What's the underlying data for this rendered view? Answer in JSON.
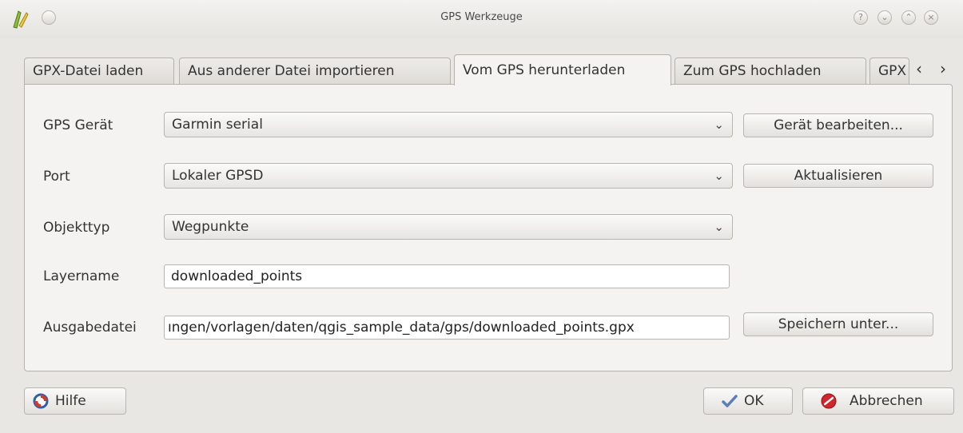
{
  "window": {
    "title": "GPS Werkzeuge",
    "controls": [
      "help-icon",
      "minimize-icon",
      "maximize-icon",
      "close-icon"
    ]
  },
  "tabs": [
    {
      "label": "GPX-Datei laden",
      "active": false
    },
    {
      "label": "Aus anderer Datei importieren",
      "active": false
    },
    {
      "label": "Vom GPS herunterladen",
      "active": true
    },
    {
      "label": "Zum GPS hochladen",
      "active": false
    },
    {
      "label": "GPX",
      "active": false
    }
  ],
  "form": {
    "gps_device": {
      "label": "GPS Gerät",
      "value": "Garmin serial",
      "button": "Gerät bearbeiten..."
    },
    "port": {
      "label": "Port",
      "value": "Lokaler GPSD",
      "button": "Aktualisieren"
    },
    "feature_type": {
      "label": "Objekttyp",
      "value": "Wegpunkte"
    },
    "layer_name": {
      "label": "Layername",
      "value": "downloaded_points"
    },
    "output_file": {
      "label": "Ausgabedatei",
      "value": "ıngen/vorlagen/daten/qgis_sample_data/gps/downloaded_points.gpx",
      "button": "Speichern unter..."
    }
  },
  "footer": {
    "help": "Hilfe",
    "ok": "OK",
    "cancel": "Abbrechen"
  },
  "colors": {
    "window_bg": "#e9e7e3",
    "panel_bg": "#f4f3f1",
    "ok_check": "#5a7fb8",
    "cancel_red": "#d0262c"
  }
}
